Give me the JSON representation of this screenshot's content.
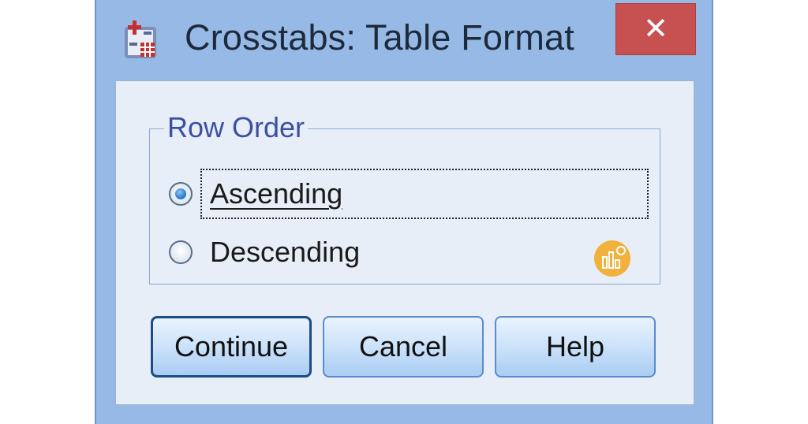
{
  "dialog": {
    "title": "Crosstabs: Table Format",
    "close_label": "✕",
    "app_icon": "crosstabs-table-icon"
  },
  "row_order": {
    "legend": "Row Order",
    "options": [
      {
        "label": "Ascending",
        "selected": true
      },
      {
        "label": "Descending",
        "selected": false
      }
    ]
  },
  "buttons": {
    "continue": "Continue",
    "cancel": "Cancel",
    "help": "Help"
  },
  "overlay_icon": "chart-badge-icon",
  "colors": {
    "titlebar": "#96b9e6",
    "close": "#c75050",
    "legend_text": "#3c4fa0",
    "radio_selected": "#2f7fd1",
    "badge": "#f0b23c"
  }
}
